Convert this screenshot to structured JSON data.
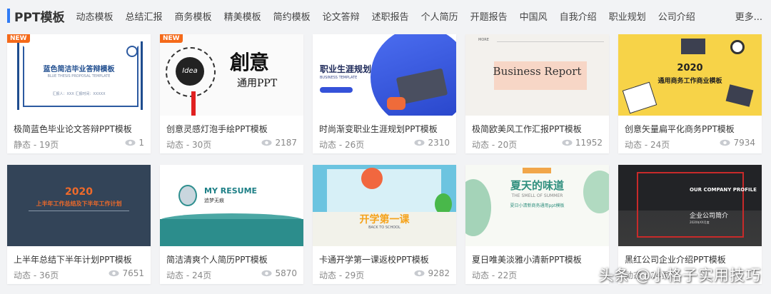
{
  "header": {
    "title": "PPT模板",
    "categories": [
      "动态模板",
      "总结汇报",
      "商务模板",
      "精美模板",
      "简约模板",
      "论文答辩",
      "述职报告",
      "个人简历",
      "开题报告",
      "中国风",
      "自我介绍",
      "职业规划",
      "公司介绍"
    ],
    "more": "更多..."
  },
  "colors": {
    "accent": "#2f7bf5",
    "new_badge": "#f56a1a"
  },
  "badge_new": "NEW",
  "cards": [
    {
      "title": "极简蓝色毕业论文答辩PPT模板",
      "meta": "静态 - 19页",
      "views": "1",
      "new": true,
      "thumb": {
        "h": "蓝色简洁毕业答辩模板",
        "sub": "BLUE THESIS PROPOSAL TEMPLATE",
        "foot": "汇报人：XXX    汇报时间：XXXXX"
      }
    },
    {
      "title": "创意灵感灯泡手绘PPT模板",
      "meta": "动态 - 30页",
      "views": "2187",
      "new": true,
      "thumb": {
        "big": "創意",
        "small": "通用PPT",
        "bulb": "Idea"
      }
    },
    {
      "title": "时尚渐变职业生涯规划PPT模板",
      "meta": "动态 - 26页",
      "views": "2310",
      "thumb": {
        "h": "职业生涯规划",
        "sub": "BUSINESS TEMPLATE"
      }
    },
    {
      "title": "极简欧美风工作汇报PPT模板",
      "meta": "动态 - 20页",
      "views": "11952",
      "thumb": {
        "h": "Business Report",
        "more": "MORE"
      }
    },
    {
      "title": "创意矢量扁平化商务PPT模板",
      "meta": "动态 - 24页",
      "views": "7934",
      "thumb": {
        "h": "2020",
        "sub": "通用商务工作商业模板"
      }
    },
    {
      "title": "上半年总结下半年计划PPT模板",
      "meta": "动态 - 36页",
      "views": "7651",
      "thumb": {
        "h": "2020",
        "sub": "上半年工作总结及下半年工作计划"
      }
    },
    {
      "title": "简洁清爽个人简历PPT模板",
      "meta": "动态 - 24页",
      "views": "5870",
      "thumb": {
        "h": "MY RESUME",
        "name": "追梦无痕"
      }
    },
    {
      "title": "卡通开学第一课返校PPT模板",
      "meta": "动态 - 29页",
      "views": "9282",
      "thumb": {
        "h": "开学第一课",
        "sub": "BACK TO SCHOOL"
      }
    },
    {
      "title": "夏日唯美淡雅小清新PPT模板",
      "meta": "动态 - 22页",
      "views": "",
      "thumb": {
        "h": "夏天的味道",
        "sub": "THE SMELL OF SUMMER",
        "sub2": "夏日小清新商务通用ppt模板",
        "tag": "SUMMER"
      }
    },
    {
      "title": "黑红公司企业介绍PPT模板",
      "meta": "动态 - 24页",
      "views": "",
      "thumb": {
        "h": "OUR COMPANY PROFILE",
        "sub": "企业公司简介",
        "sub2": "2020年XX月度"
      }
    }
  ],
  "watermark": "头条 @小格子实用技巧"
}
